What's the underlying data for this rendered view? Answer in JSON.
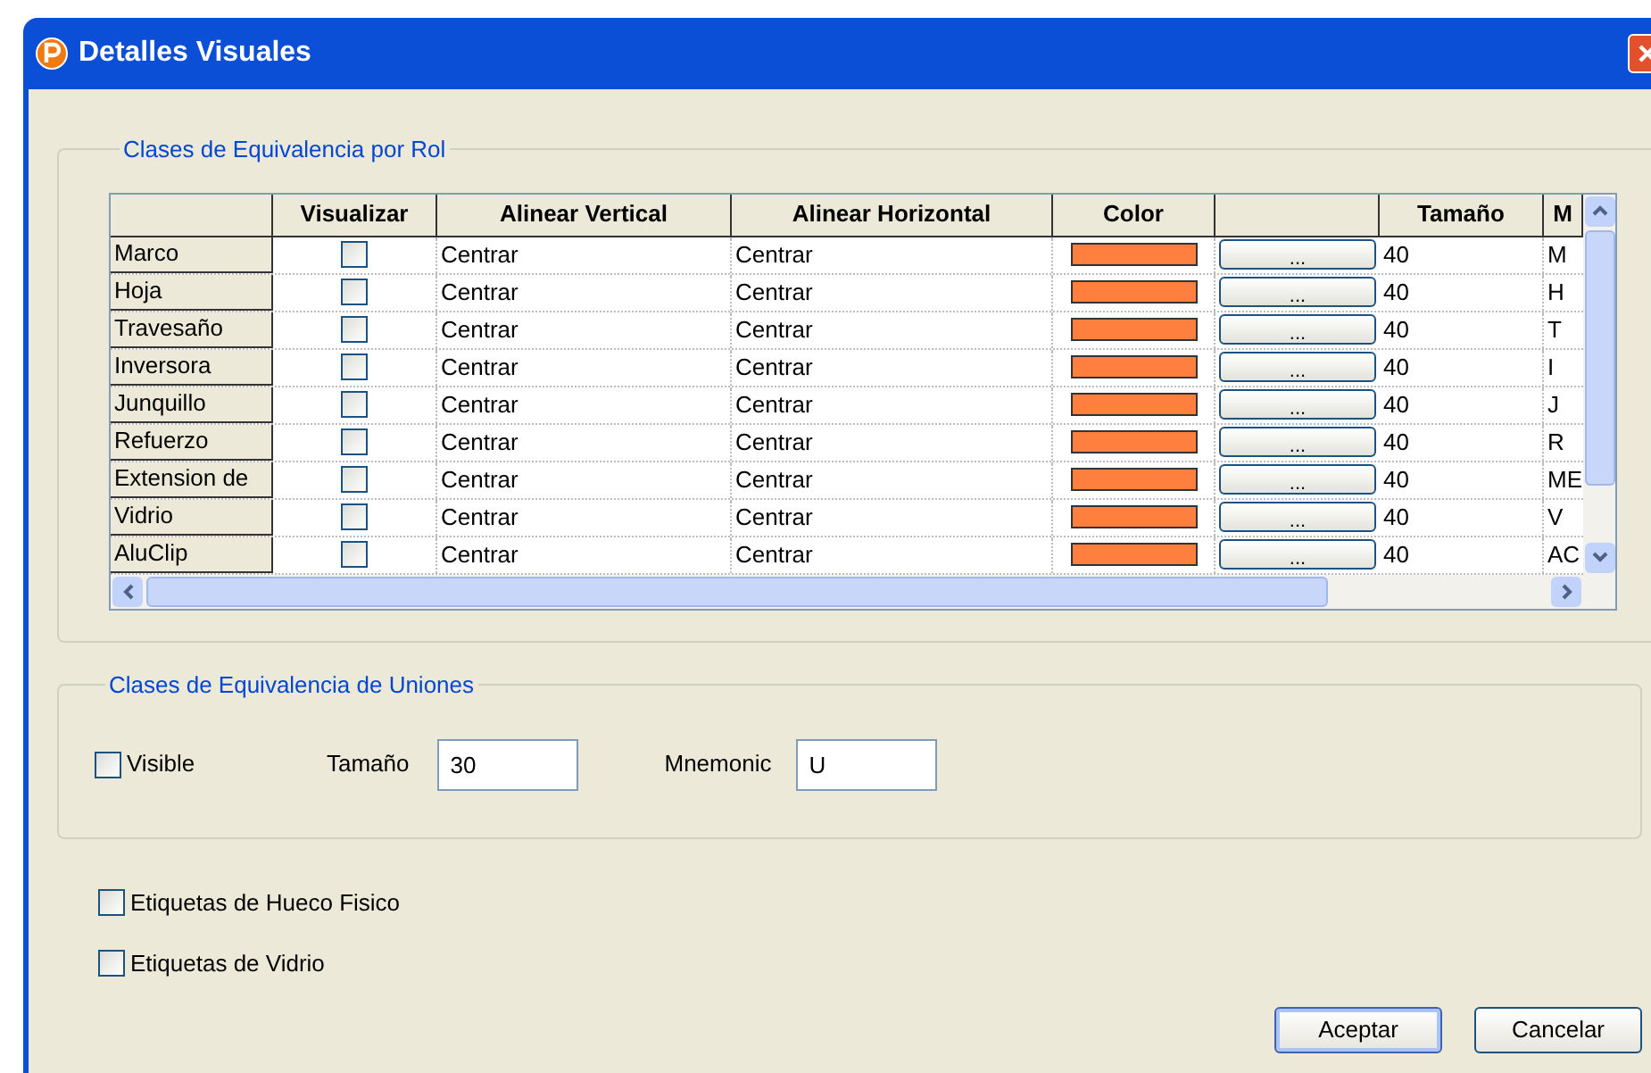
{
  "window": {
    "title": "Detalles Visuales"
  },
  "roles_group": {
    "title": "Clases de Equivalencia por Rol",
    "table": {
      "columns": [
        "Visualizar",
        "Alinear Vertical",
        "Alinear Horizontal",
        "Color",
        "Tamaño",
        "M"
      ],
      "rows": [
        {
          "name": "Marco",
          "visible": false,
          "vertical": "Centrar",
          "horizontal": "Centrar",
          "color": "#ff7f3f",
          "button": "...",
          "size": "40",
          "mnemonic": "M"
        },
        {
          "name": "Hoja",
          "visible": false,
          "vertical": "Centrar",
          "horizontal": "Centrar",
          "color": "#ff7f3f",
          "button": "...",
          "size": "40",
          "mnemonic": "H"
        },
        {
          "name": "Travesaño",
          "visible": false,
          "vertical": "Centrar",
          "horizontal": "Centrar",
          "color": "#ff7f3f",
          "button": "...",
          "size": "40",
          "mnemonic": "T"
        },
        {
          "name": "Inversora",
          "visible": false,
          "vertical": "Centrar",
          "horizontal": "Centrar",
          "color": "#ff7f3f",
          "button": "...",
          "size": "40",
          "mnemonic": "I"
        },
        {
          "name": "Junquillo",
          "visible": false,
          "vertical": "Centrar",
          "horizontal": "Centrar",
          "color": "#ff7f3f",
          "button": "...",
          "size": "40",
          "mnemonic": "J"
        },
        {
          "name": "Refuerzo",
          "visible": false,
          "vertical": "Centrar",
          "horizontal": "Centrar",
          "color": "#ff7f3f",
          "button": "...",
          "size": "40",
          "mnemonic": "R"
        },
        {
          "name": "Extension de",
          "visible": false,
          "vertical": "Centrar",
          "horizontal": "Centrar",
          "color": "#ff7f3f",
          "button": "...",
          "size": "40",
          "mnemonic": "ME"
        },
        {
          "name": "Vidrio",
          "visible": false,
          "vertical": "Centrar",
          "horizontal": "Centrar",
          "color": "#ff7f3f",
          "button": "...",
          "size": "40",
          "mnemonic": "V"
        },
        {
          "name": "AluClip",
          "visible": false,
          "vertical": "Centrar",
          "horizontal": "Centrar",
          "color": "#ff7f3f",
          "button": "...",
          "size": "40",
          "mnemonic": "AC"
        }
      ]
    }
  },
  "unions_group": {
    "title": "Clases de Equivalencia de Uniones",
    "visible": {
      "label": "Visible",
      "checked": false
    },
    "size": {
      "label": "Tamaño",
      "value": "30"
    },
    "mnemonic": {
      "label": "Mnemonic",
      "value": "U"
    }
  },
  "options": [
    {
      "label": "Etiquetas de Hueco Fisico",
      "checked": false
    },
    {
      "label": "Etiquetas de Vidrio",
      "checked": false
    }
  ],
  "buttons": [
    {
      "label": "Aceptar",
      "selected": true
    },
    {
      "label": "Cancelar",
      "selected": false
    }
  ]
}
